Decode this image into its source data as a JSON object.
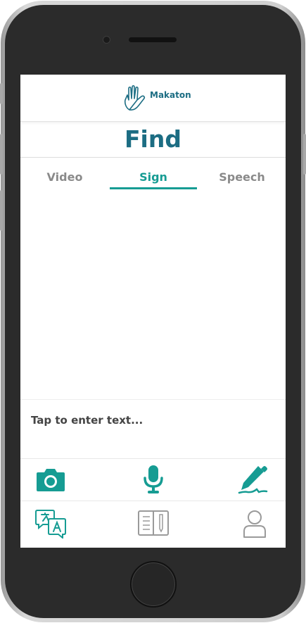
{
  "header": {
    "logo_text": "Makaton"
  },
  "page": {
    "title": "Find"
  },
  "tabs": [
    {
      "label": "Video",
      "active": false
    },
    {
      "label": "Sign",
      "active": true
    },
    {
      "label": "Speech",
      "active": false
    }
  ],
  "input": {
    "placeholder": "Tap to enter text..."
  },
  "tools": {
    "icons": [
      "camera-icon",
      "microphone-icon",
      "pen-icon"
    ]
  },
  "nav": {
    "icons": [
      "translate-icon",
      "notebook-icon",
      "profile-icon"
    ]
  },
  "colors": {
    "brand": "#1c6d83",
    "accent": "#169c93",
    "inactive": "#8a8a8a"
  }
}
